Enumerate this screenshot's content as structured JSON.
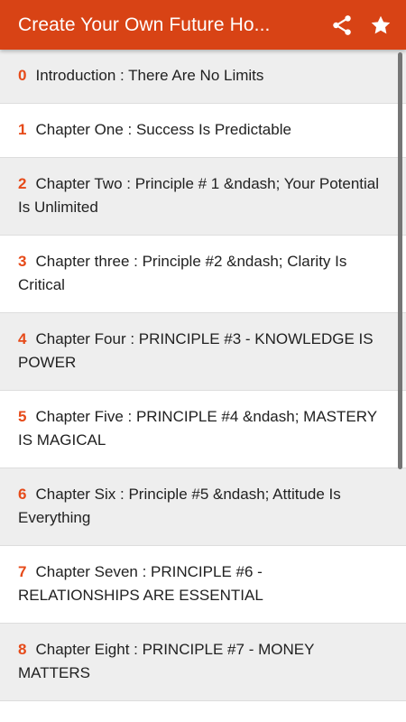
{
  "app_bar": {
    "title": "Create Your Own Future Ho...",
    "background_color": "#d84315",
    "icons": [
      "share-icon",
      "star-icon"
    ]
  },
  "accent_color": "#e64a19",
  "chapters": [
    {
      "number": "0",
      "title": "Introduction : There Are No Limits"
    },
    {
      "number": "1",
      "title": "Chapter One : Success Is Predictable"
    },
    {
      "number": "2",
      "title": "Chapter Two : Principle # 1 &ndash; Your Potential Is Unlimited"
    },
    {
      "number": "3",
      "title": "Chapter three : Principle #2 &ndash; Clarity Is Critical"
    },
    {
      "number": "4",
      "title": "Chapter Four : PRINCIPLE #3 - KNOWLEDGE IS POWER"
    },
    {
      "number": "5",
      "title": "Chapter Five : PRINCIPLE #4 &ndash; MASTERY IS MAGICAL"
    },
    {
      "number": "6",
      "title": "Chapter Six : Principle #5 &ndash; Attitude Is Everything"
    },
    {
      "number": "7",
      "title": "Chapter Seven : PRINCIPLE #6 - RELATIONSHIPS ARE ESSENTIAL"
    },
    {
      "number": "8",
      "title": "Chapter Eight : PRINCIPLE #7 - MONEY MATTERS"
    }
  ]
}
